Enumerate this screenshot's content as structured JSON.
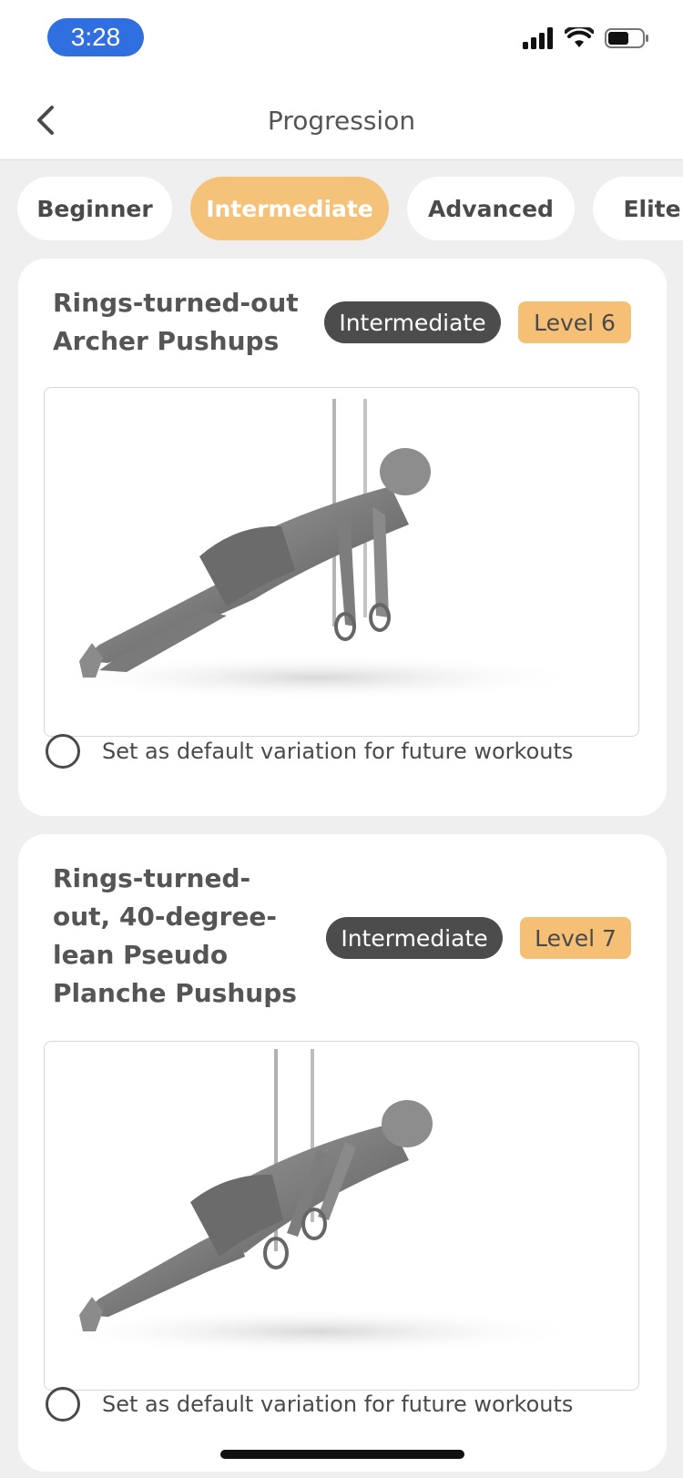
{
  "status_bar": {
    "time": "3:28"
  },
  "nav": {
    "title": "Progression"
  },
  "tabs": [
    {
      "label": "Beginner",
      "active": false
    },
    {
      "label": "Intermediate",
      "active": true
    },
    {
      "label": "Advanced",
      "active": false
    },
    {
      "label": "Elite",
      "active": false
    }
  ],
  "exercises": [
    {
      "title": "Rings-turned-out Archer Pushups",
      "difficulty": "Intermediate",
      "level": "Level 6",
      "default_label": "Set as default variation for future workouts"
    },
    {
      "title": "Rings-turned-out, 40-degree-lean Pseudo Planche Pushups",
      "difficulty": "Intermediate",
      "level": "Level 7",
      "default_label": "Set as default variation for future workouts"
    }
  ],
  "colors": {
    "accent": "#f5c27a",
    "badge_dark": "#4c4c4c",
    "time_pill": "#2f6fe0"
  }
}
